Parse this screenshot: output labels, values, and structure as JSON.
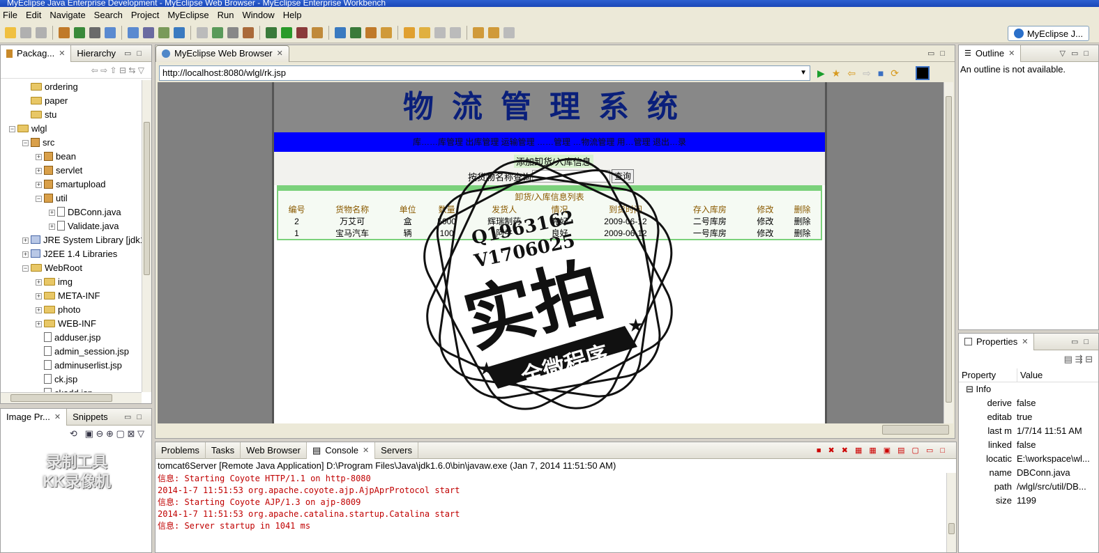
{
  "window": {
    "title": "MyEclipse Java Enterprise Development - MyEclipse Web Browser - MyEclipse Enterprise Workbench"
  },
  "menu": [
    "File",
    "Edit",
    "Navigate",
    "Search",
    "Project",
    "MyEclipse",
    "Run",
    "Window",
    "Help"
  ],
  "perspective": {
    "label": "MyEclipse J..."
  },
  "package_explorer": {
    "tabs": [
      "Packag...",
      "Hierarchy"
    ],
    "items": [
      {
        "label": "ordering",
        "kind": "folder",
        "indent": 1
      },
      {
        "label": "paper",
        "kind": "folder",
        "indent": 1
      },
      {
        "label": "stu",
        "kind": "folder",
        "indent": 1
      },
      {
        "label": "wlgl",
        "kind": "project",
        "indent": 0,
        "exp": "−"
      },
      {
        "label": "src",
        "kind": "src",
        "indent": 1,
        "exp": "−"
      },
      {
        "label": "bean",
        "kind": "pkg",
        "indent": 2,
        "exp": "+"
      },
      {
        "label": "servlet",
        "kind": "pkg",
        "indent": 2,
        "exp": "+"
      },
      {
        "label": "smartupload",
        "kind": "pkg",
        "indent": 2,
        "exp": "+"
      },
      {
        "label": "util",
        "kind": "pkg",
        "indent": 2,
        "exp": "−"
      },
      {
        "label": "DBConn.java",
        "kind": "file",
        "indent": 3,
        "exp": "+"
      },
      {
        "label": "Validate.java",
        "kind": "file",
        "indent": 3,
        "exp": "+"
      },
      {
        "label": "JRE System Library [jdk1",
        "kind": "lib",
        "indent": 1,
        "exp": "+"
      },
      {
        "label": "J2EE 1.4 Libraries",
        "kind": "lib",
        "indent": 1,
        "exp": "+"
      },
      {
        "label": "WebRoot",
        "kind": "folder",
        "indent": 1,
        "exp": "−"
      },
      {
        "label": "img",
        "kind": "folder",
        "indent": 2,
        "exp": "+"
      },
      {
        "label": "META-INF",
        "kind": "folder",
        "indent": 2,
        "exp": "+"
      },
      {
        "label": "photo",
        "kind": "folder",
        "indent": 2,
        "exp": "+"
      },
      {
        "label": "WEB-INF",
        "kind": "folder",
        "indent": 2,
        "exp": "+"
      },
      {
        "label": "adduser.jsp",
        "kind": "file",
        "indent": 2
      },
      {
        "label": "admin_session.jsp",
        "kind": "file",
        "indent": 2
      },
      {
        "label": "adminuserlist.jsp",
        "kind": "file",
        "indent": 2
      },
      {
        "label": "ck.jsp",
        "kind": "file",
        "indent": 2
      },
      {
        "label": "ckadd.jsp",
        "kind": "file",
        "indent": 2
      }
    ]
  },
  "image_panel": {
    "tabs": [
      "Image Pr...",
      "Snippets"
    ]
  },
  "editor": {
    "tab": "MyEclipse Web Browser",
    "url": "http://localhost:8080/wlgl/rk.jsp"
  },
  "webpage": {
    "title": "物流管理系统",
    "nav": "库……库管理  出库管理  运输管理  ……管理  …物流管理  用…管理  退出…录",
    "add_link": "添加卸货/入库信息",
    "search_label": "按货物名称查询",
    "search_button": "查询",
    "list_title": "卸货/入库信息列表",
    "columns": [
      "编号",
      "货物名称",
      "单位",
      "数量",
      "发货人",
      "",
      "情况",
      "到货时间",
      "",
      "存入库房",
      "修改",
      "删除"
    ],
    "rows": [
      [
        "2",
        "万艾可",
        "盒",
        "5000",
        "辉瑞制药",
        "",
        "完好",
        "2009-06-12",
        "",
        "二号库房",
        "修改",
        "删除"
      ],
      [
        "1",
        "宝马汽车",
        "辆",
        "100",
        "阿牛",
        "",
        "良好",
        "2009-06-12",
        "",
        "一号库房",
        "修改",
        "删除"
      ]
    ]
  },
  "outline": {
    "tab": "Outline",
    "message": "An outline is not available."
  },
  "properties": {
    "tab": "Properties",
    "col_property": "Property",
    "col_value": "Value",
    "group": "Info",
    "rows": [
      {
        "k": "derive",
        "v": "false"
      },
      {
        "k": "editab",
        "v": "true"
      },
      {
        "k": "last m",
        "v": "1/7/14 11:51 AM"
      },
      {
        "k": "linked",
        "v": "false"
      },
      {
        "k": "locatic",
        "v": "E:\\workspace\\wl..."
      },
      {
        "k": "name",
        "v": "DBConn.java"
      },
      {
        "k": "path",
        "v": "/wlgl/src/util/DB..."
      },
      {
        "k": "size",
        "v": "1199"
      }
    ]
  },
  "console": {
    "tabs": [
      "Problems",
      "Tasks",
      "Web Browser",
      "Console",
      "Servers"
    ],
    "header": "tomcat6Server [Remote Java Application] D:\\Program Files\\Java\\jdk1.6.0\\bin\\javaw.exe (Jan 7, 2014 11:51:50 AM)",
    "lines": [
      "信息: Starting Coyote HTTP/1.1 on http-8080",
      "2014-1-7 11:51:53 org.apache.coyote.ajp.AjpAprProtocol start",
      "信息: Starting Coyote AJP/1.3 on ajp-8009",
      "2014-1-7 11:51:53 org.apache.catalina.startup.Catalina start",
      "信息: Server startup in 1041 ms"
    ]
  },
  "overlay_stamp": {
    "line1": "Q1963162",
    "line2": "V1706025",
    "big": "实拍",
    "banner": "全微程序"
  },
  "watermark": {
    "line1": "录制工具",
    "line2": "KK录像机"
  }
}
